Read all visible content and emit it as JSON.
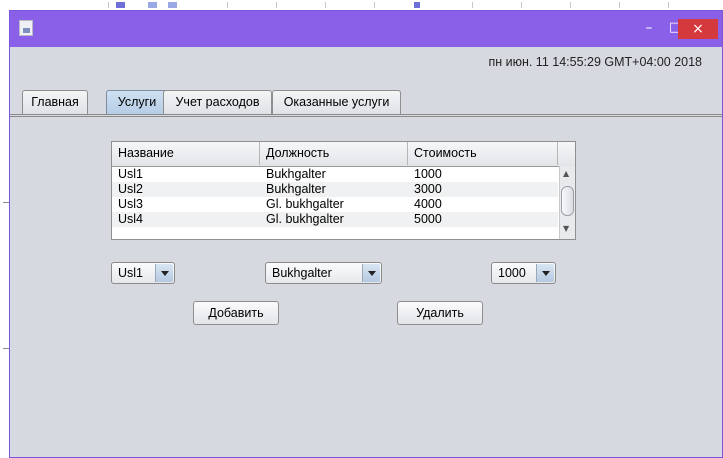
{
  "window": {
    "controls": {
      "minimize": "–",
      "maximize": "□",
      "close": "×"
    },
    "datetime": "пн июн. 11 14:55:29 GMT+04:00 2018"
  },
  "tabs": [
    {
      "label": "Главная",
      "selected": false
    },
    {
      "label": "Услуги",
      "selected": true
    },
    {
      "label": "Учет расходов",
      "selected": false
    },
    {
      "label": "Оказанные услуги",
      "selected": false
    }
  ],
  "table": {
    "columns": [
      "Название",
      "Должность",
      "Стоимость"
    ],
    "rows": [
      [
        "Usl1",
        "Bukhgalter",
        "1000"
      ],
      [
        "Usl2",
        "Bukhgalter",
        "3000"
      ],
      [
        "Usl3",
        "Gl. bukhgalter",
        "4000"
      ],
      [
        "Usl4",
        "Gl. bukhgalter",
        "5000"
      ]
    ]
  },
  "form": {
    "service_select": "Usl1",
    "position_select": "Bukhgalter",
    "price_select": "1000",
    "add_label": "Добавить",
    "delete_label": "Удалить"
  },
  "colors": {
    "titlebar": "#8a60e8",
    "close": "#d4393d",
    "panel": "#d6d9df"
  }
}
